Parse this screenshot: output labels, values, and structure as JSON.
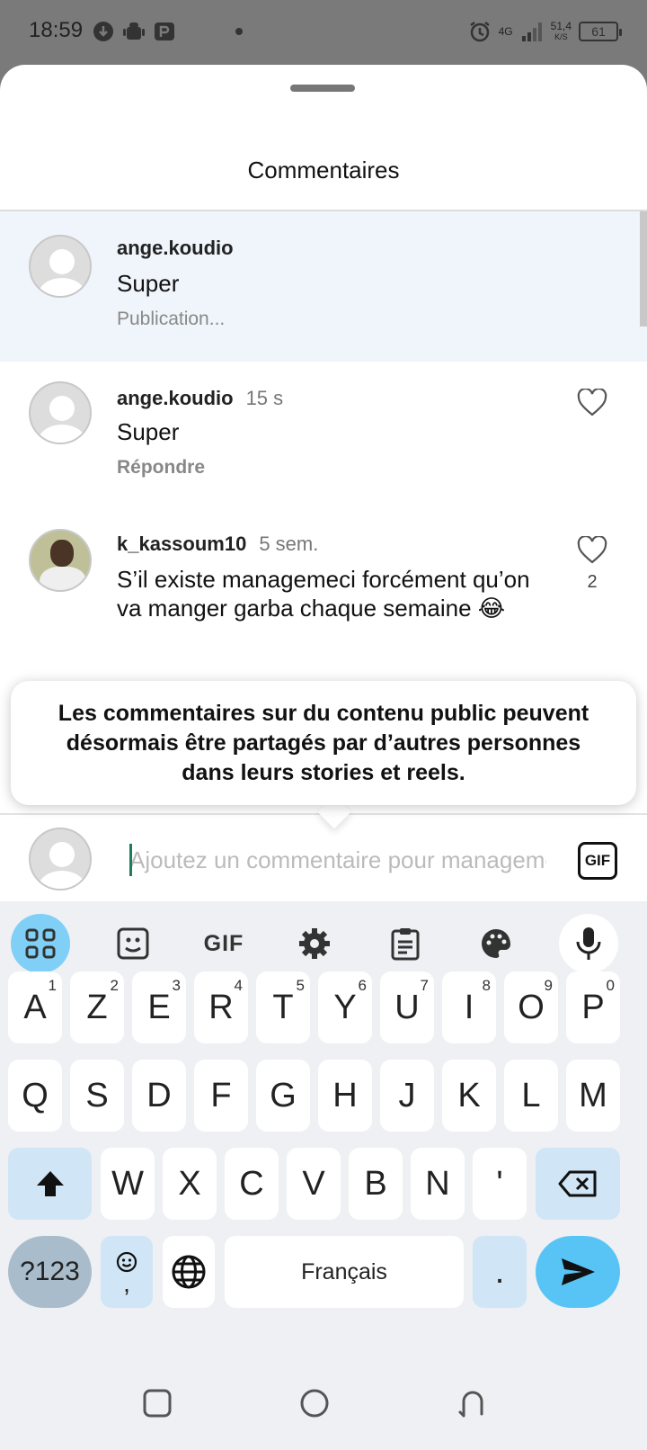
{
  "status_bar": {
    "time": "18:59",
    "network": "4G",
    "speed_value": "51,4",
    "speed_unit": "K/S",
    "battery": "61"
  },
  "sheet": {
    "title": "Commentaires"
  },
  "comments": [
    {
      "username": "ange.koudio",
      "time": "",
      "text": "Super",
      "meta": "Publication...",
      "pending": true
    },
    {
      "username": "ange.koudio",
      "time": "15 s",
      "text": "Super",
      "meta": "Répondre",
      "likes": ""
    },
    {
      "username": "k_kassoum10",
      "time": "5 sem.",
      "text": "S’il existe managemeci forcément qu’on va manger garba chaque semaine 😂",
      "likes": "2"
    }
  ],
  "tooltip": {
    "text": "Les commentaires sur du contenu public peuvent désormais être partagés par d’autres personnes dans leurs stories et reels."
  },
  "compose": {
    "placeholder": "Ajoutez un commentaire pour managemeci",
    "gif_label": "GIF"
  },
  "keyboard": {
    "toolbar": [
      "apps-icon",
      "sticker-icon",
      "gif-icon",
      "settings-icon",
      "clipboard-icon",
      "palette-icon",
      "mic-icon"
    ],
    "toolbar_gif": "GIF",
    "row1": [
      {
        "key": "A",
        "hint": "1"
      },
      {
        "key": "Z",
        "hint": "2"
      },
      {
        "key": "E",
        "hint": "3"
      },
      {
        "key": "R",
        "hint": "4"
      },
      {
        "key": "T",
        "hint": "5"
      },
      {
        "key": "Y",
        "hint": "6"
      },
      {
        "key": "U",
        "hint": "7"
      },
      {
        "key": "I",
        "hint": "8"
      },
      {
        "key": "O",
        "hint": "9"
      },
      {
        "key": "P",
        "hint": "0"
      }
    ],
    "row2": [
      "Q",
      "S",
      "D",
      "F",
      "G",
      "H",
      "J",
      "K",
      "L",
      "M"
    ],
    "row3": [
      "W",
      "X",
      "C",
      "V",
      "B",
      "N",
      "'"
    ],
    "symbols_label": "?123",
    "emoji_comma": ",",
    "space_label": "Français",
    "period_label": "."
  },
  "colors": {
    "accent": "#58c4f5",
    "pending_bg": "#eff5fb"
  }
}
